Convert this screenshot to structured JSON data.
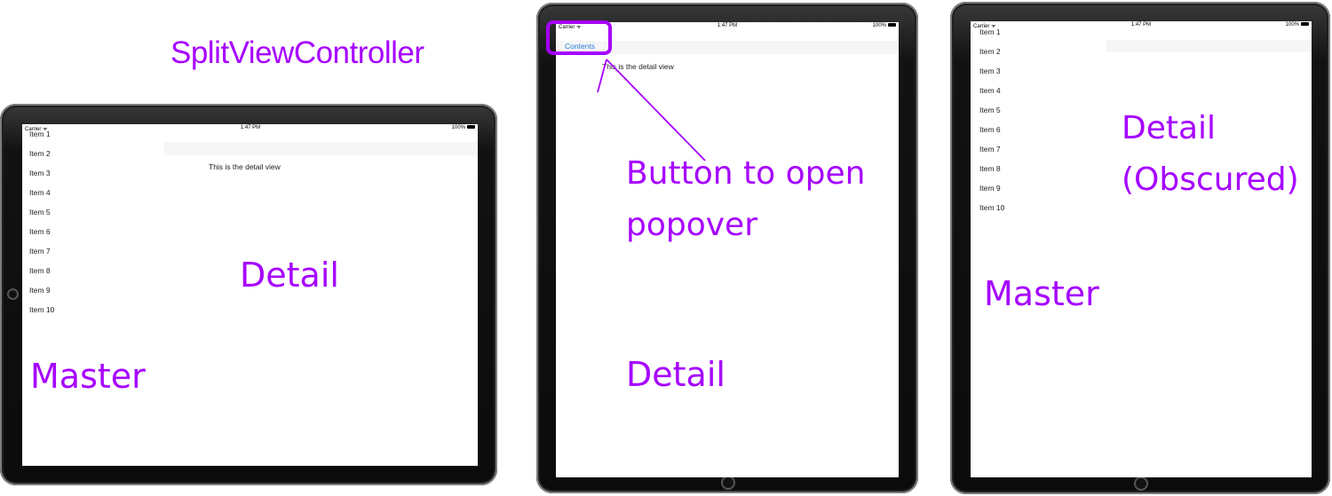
{
  "title": "SplitViewController",
  "status": {
    "carrier": "Carrier ᯤ",
    "time": "1:47 PM",
    "battery": "100%"
  },
  "master_items": [
    "Item 1",
    "Item 2",
    "Item 3",
    "Item 4",
    "Item 5",
    "Item 6",
    "Item 7",
    "Item 8",
    "Item 9",
    "Item 10"
  ],
  "detail_view_text": "This is the detail view",
  "contents_button_label": "Contents",
  "annotations": {
    "landscape_detail": "Detail",
    "landscape_master": "Master",
    "portrait_button": "Button to open\npopover",
    "portrait_detail": "Detail",
    "popover_detail": "Detail\n(Obscured)",
    "popover_master": "Master"
  },
  "colors": {
    "annotation": "#a600ff",
    "link": "#2a7cd6",
    "bezel": "#0b0b0b"
  }
}
